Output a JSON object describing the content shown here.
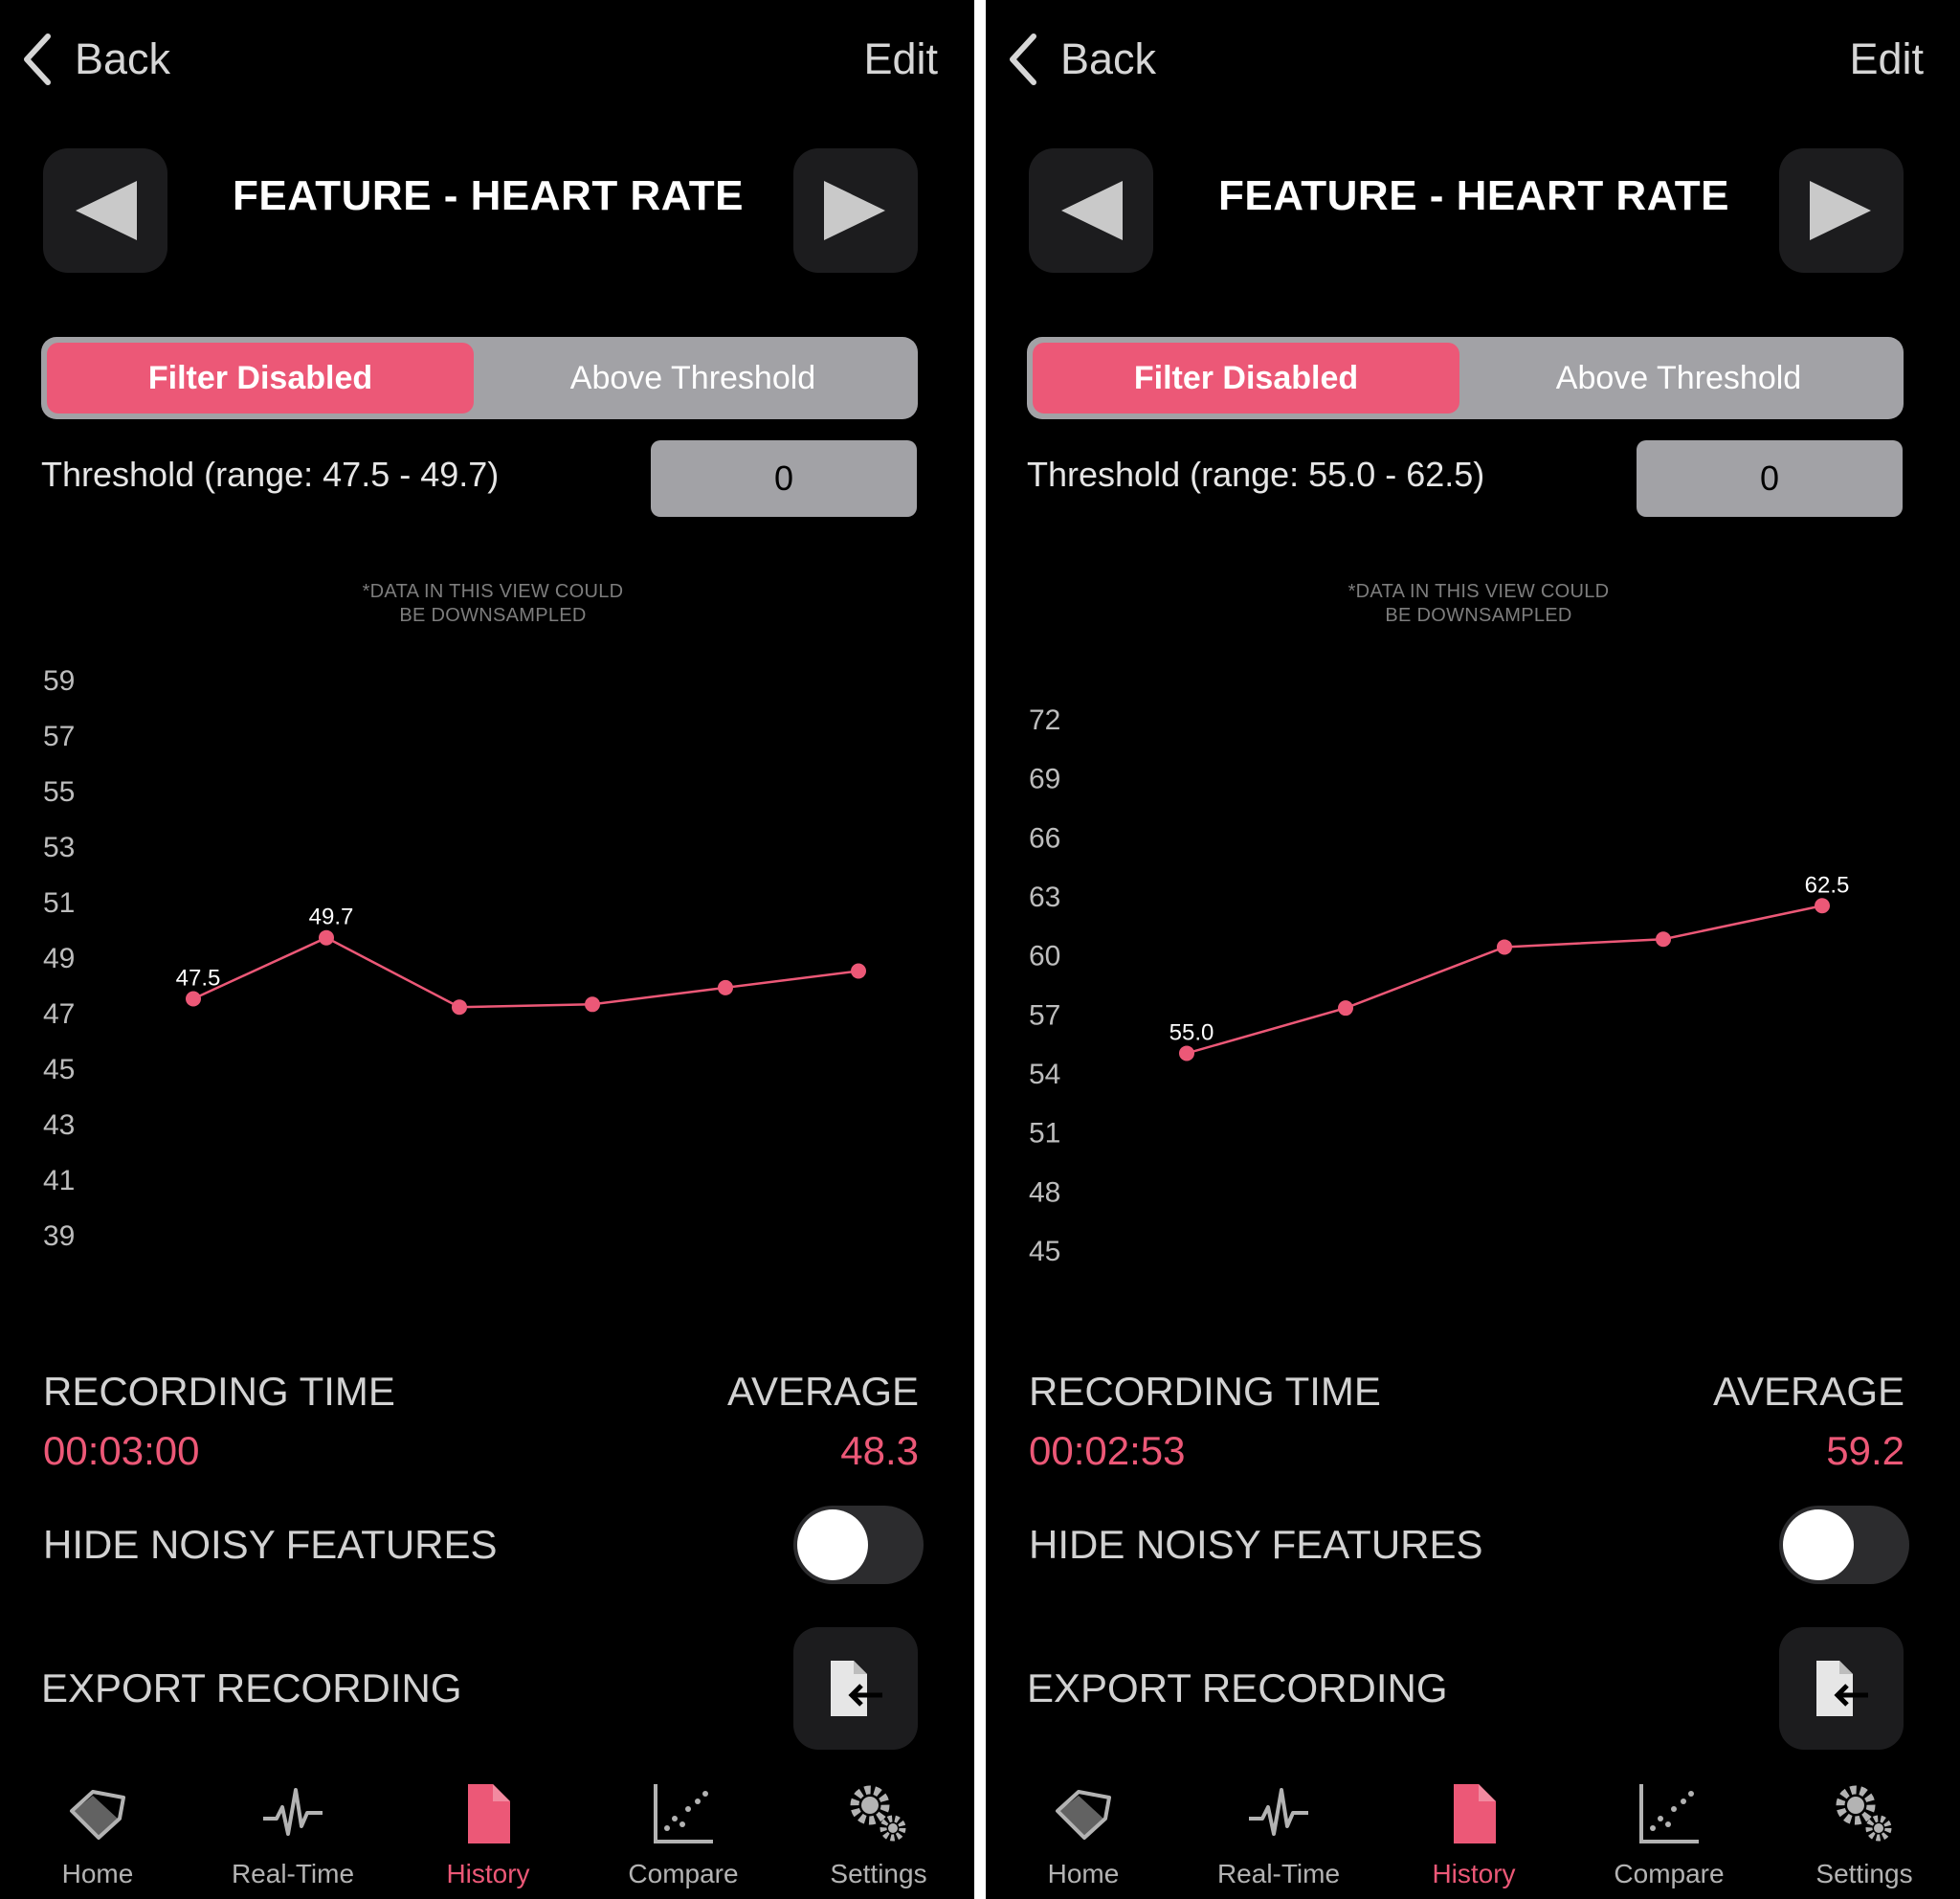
{
  "colors": {
    "accent": "#ec5877",
    "background": "#000000",
    "segment_bg": "#a2a2a6",
    "button_bg": "#1c1c1e"
  },
  "screens": [
    {
      "nav": {
        "back_label": "Back",
        "edit_label": "Edit"
      },
      "feature_title": "FEATURE - HEART RATE",
      "filter": {
        "options": [
          "Filter Disabled",
          "Above Threshold"
        ],
        "selected": "Filter Disabled"
      },
      "threshold": {
        "label": "Threshold (range: 47.5 - 49.7)",
        "value": "0"
      },
      "downsample_note": [
        "*DATA IN THIS VIEW COULD",
        "BE DOWNSAMPLED"
      ],
      "stats": {
        "recording_time_label": "RECORDING TIME",
        "recording_time": "00:03:00",
        "average_label": "AVERAGE",
        "average": "48.3"
      },
      "hide_noisy": {
        "label": "HIDE NOISY FEATURES",
        "on": false
      },
      "export": {
        "label": "EXPORT RECORDING",
        "icon": "export-file-icon"
      }
    },
    {
      "nav": {
        "back_label": "Back",
        "edit_label": "Edit"
      },
      "feature_title": "FEATURE - HEART RATE",
      "filter": {
        "options": [
          "Filter Disabled",
          "Above Threshold"
        ],
        "selected": "Filter Disabled"
      },
      "threshold": {
        "label": "Threshold (range: 55.0 - 62.5)",
        "value": "0"
      },
      "downsample_note": [
        "*DATA IN THIS VIEW COULD",
        "BE DOWNSAMPLED"
      ],
      "stats": {
        "recording_time_label": "RECORDING TIME",
        "recording_time": "00:02:53",
        "average_label": "AVERAGE",
        "average": "59.2"
      },
      "hide_noisy": {
        "label": "HIDE NOISY FEATURES",
        "on": false
      },
      "export": {
        "label": "EXPORT RECORDING",
        "icon": "export-file-icon"
      }
    }
  ],
  "tabbar": {
    "items": [
      {
        "label": "Home",
        "icon": "heart-tag-icon"
      },
      {
        "label": "Real-Time",
        "icon": "pulse-icon"
      },
      {
        "label": "History",
        "icon": "document-icon"
      },
      {
        "label": "Compare",
        "icon": "scatter-plot-icon"
      },
      {
        "label": "Settings",
        "icon": "gears-icon"
      }
    ],
    "active": "History"
  },
  "chart_data": [
    {
      "type": "line",
      "x": [
        1,
        2,
        3,
        4,
        5,
        6
      ],
      "series": [
        {
          "values": [
            47.5,
            49.7,
            47.2,
            47.3,
            47.9,
            48.5
          ],
          "color": "#ec5877"
        }
      ],
      "data_labels": [
        {
          "index": 0,
          "text": "47.5"
        },
        {
          "index": 1,
          "text": "49.7"
        }
      ],
      "y_ticks": [
        59,
        57,
        55,
        53,
        51,
        49,
        47,
        45,
        43,
        41,
        39
      ],
      "ylim": [
        39,
        59
      ],
      "grid": false
    },
    {
      "type": "line",
      "x": [
        1,
        2,
        3,
        4,
        5
      ],
      "series": [
        {
          "values": [
            55.0,
            57.3,
            60.4,
            60.8,
            62.5
          ],
          "color": "#ec5877"
        }
      ],
      "data_labels": [
        {
          "index": 0,
          "text": "55.0"
        },
        {
          "index": 4,
          "text": "62.5"
        }
      ],
      "y_ticks": [
        72,
        69,
        66,
        63,
        60,
        57,
        54,
        51,
        48,
        45
      ],
      "ylim": [
        45,
        72
      ],
      "grid": false
    }
  ]
}
